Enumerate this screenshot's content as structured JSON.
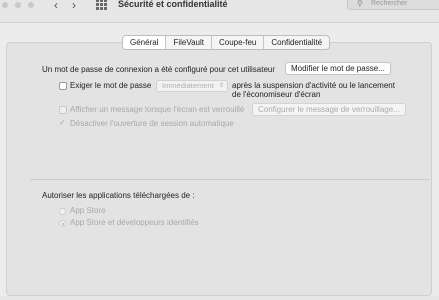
{
  "window": {
    "title": "Sécurité et confidentialité",
    "search_placeholder": "Rechercher"
  },
  "tabs": [
    {
      "label": "Général",
      "active": true
    },
    {
      "label": "FileVault",
      "active": false
    },
    {
      "label": "Coupe-feu",
      "active": false
    },
    {
      "label": "Confidentialité",
      "active": false
    }
  ],
  "general": {
    "password_info": "Un mot de passe de connexion a été configuré pour cet utilisateur",
    "change_password_button": "Modifier le mot de passe...",
    "require_password_label": "Exiger le mot de passe",
    "require_password_checked": false,
    "delay_value": "Immédiatement",
    "after_sleep_line1": "après la suspension d'activité ou le lancement",
    "after_sleep_line2": "de l'économiseur d'écran",
    "show_message_label": "Afficher un message lorsque l'écran est verrouillé",
    "configure_lock_message_button": "Configurer le message de verrouillage...",
    "disable_autologin_label": "Désactiver l'ouverture de session automatique",
    "disable_autologin_checked": true
  },
  "downloads": {
    "heading": "Autoriser les applications téléchargées de :",
    "options": [
      {
        "label": "App Store",
        "selected": false
      },
      {
        "label": "App Store et développeurs identifiés",
        "selected": true
      }
    ]
  },
  "icons": {
    "back": "chevron-left-icon",
    "forward": "chevron-right-icon",
    "grid": "grid-icon",
    "search": "search-icon"
  }
}
